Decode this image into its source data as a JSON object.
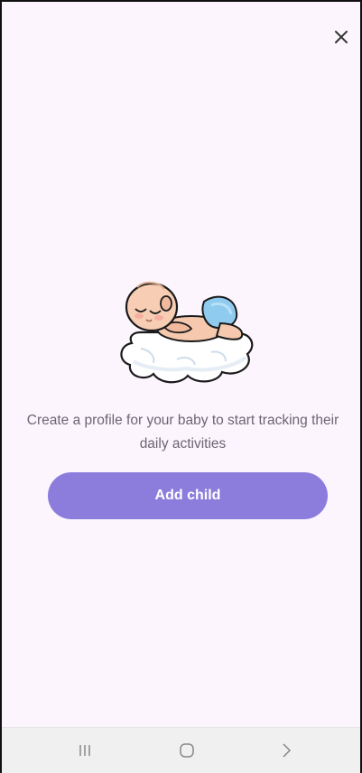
{
  "header": {
    "close_icon": "close-icon"
  },
  "empty_state": {
    "illustration": "sleeping-baby-on-cloud",
    "message": "Create a profile for your baby to start tracking their daily activities"
  },
  "actions": {
    "add_child_label": "Add child"
  },
  "system_nav": {
    "items": [
      "recent-apps-icon",
      "home-icon",
      "back-icon"
    ]
  },
  "colors": {
    "background": "#fcf5fd",
    "primary_button": "#8c7ddd",
    "text_secondary": "#6b6670",
    "nav_bar": "#f0f0f0"
  }
}
